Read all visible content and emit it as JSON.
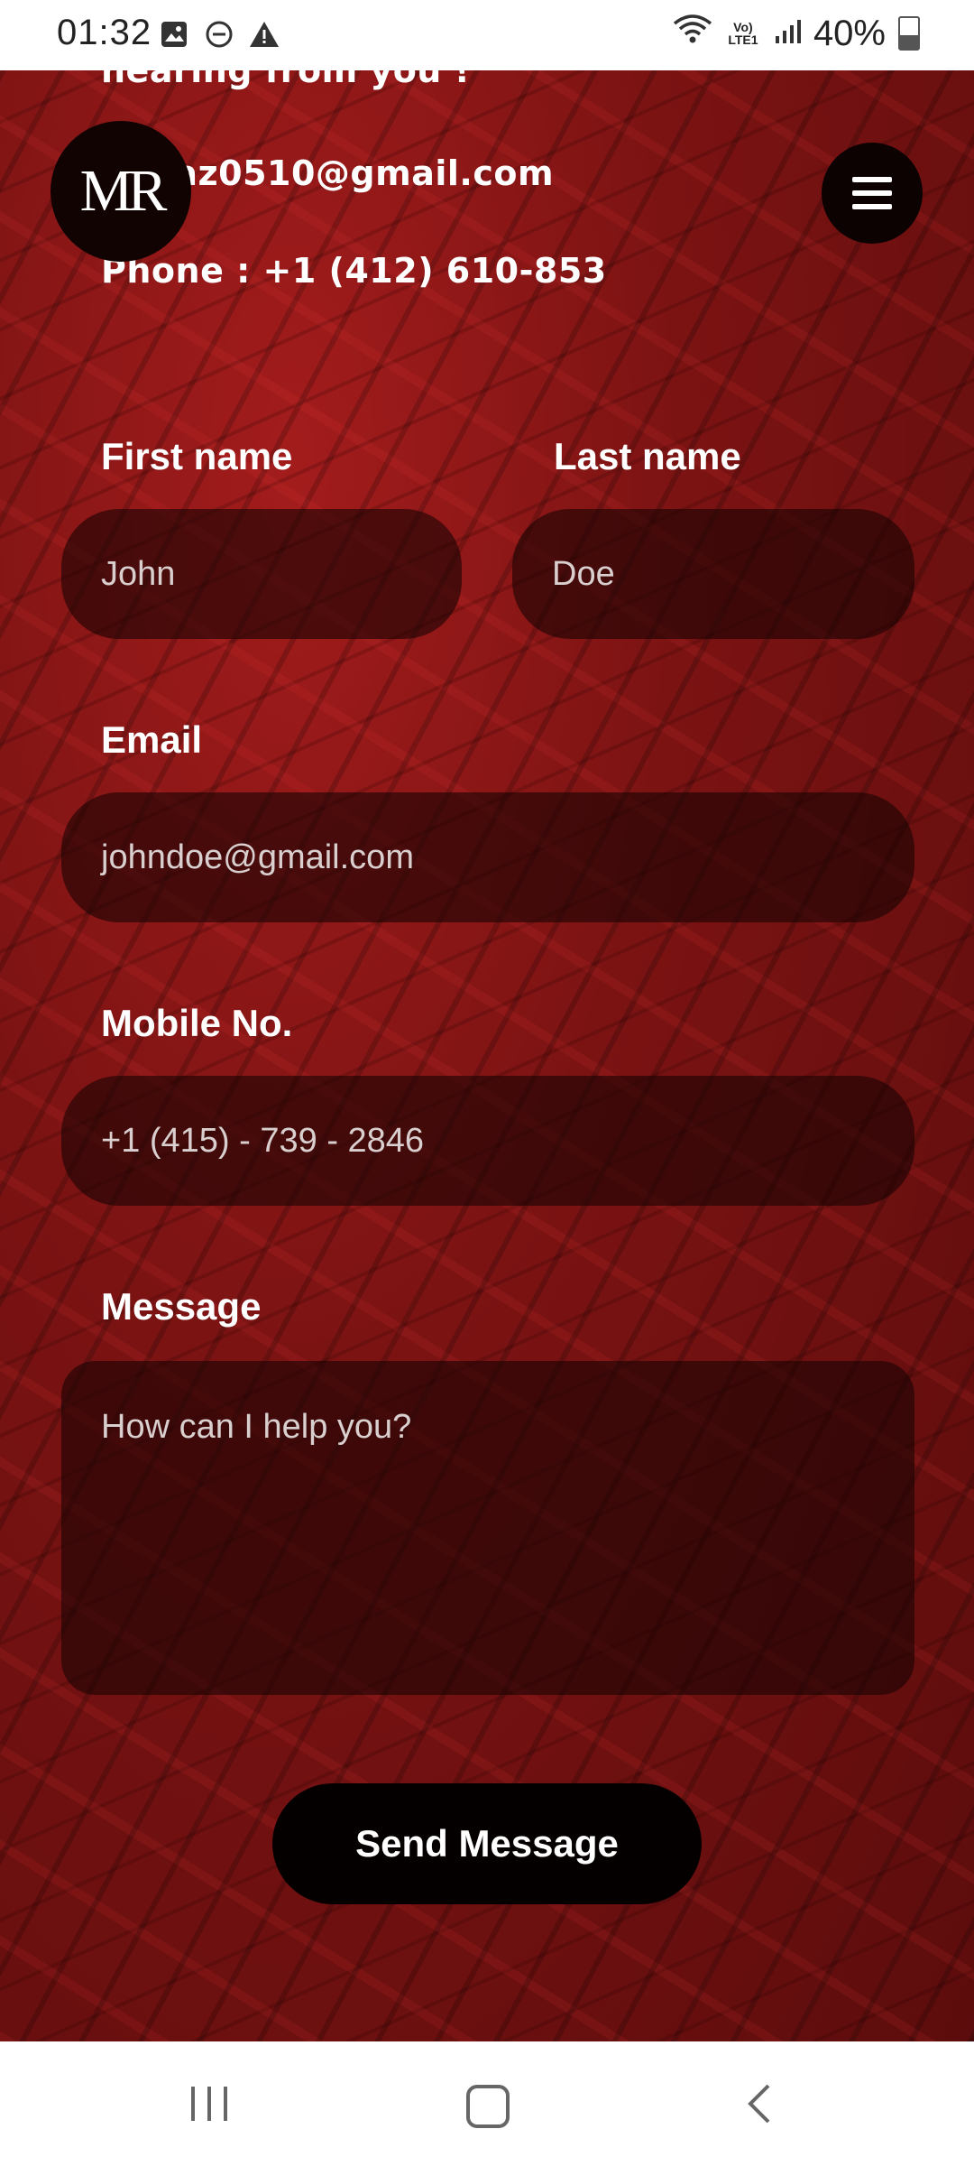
{
  "status_bar": {
    "time": "01:32",
    "battery": "40%",
    "icons": [
      "image-icon",
      "dnd-icon",
      "warning-icon",
      "wifi-icon",
      "volte-icon",
      "signal-icon",
      "battery-icon"
    ],
    "volte_text": "Vo) LTE1"
  },
  "contact": {
    "partial_line": "hearing from you !",
    "email": "ganaz0510@gmail.com",
    "phone": "Phone : +1 (412) 610-853"
  },
  "logo": {
    "text": "MR"
  },
  "form": {
    "first_name": {
      "label": "First name",
      "placeholder": "John"
    },
    "last_name": {
      "label": "Last name",
      "placeholder": "Doe"
    },
    "email": {
      "label": "Email",
      "placeholder": "johndoe@gmail.com"
    },
    "mobile": {
      "label": "Mobile No.",
      "placeholder": "+1 (415) - 739 - 2846"
    },
    "message": {
      "label": "Message",
      "placeholder": "How can I help you?"
    },
    "submit_label": "Send Message"
  },
  "colors": {
    "background_red": "#7c1313",
    "field_bg": "#1c0303",
    "button_bg": "#050000"
  }
}
